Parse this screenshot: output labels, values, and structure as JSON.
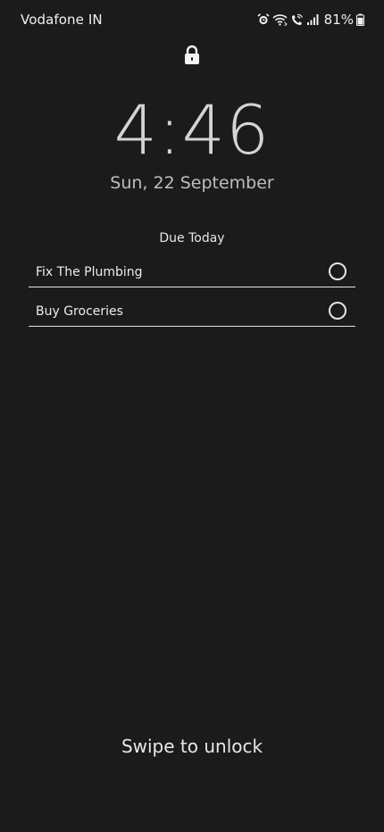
{
  "status_bar": {
    "carrier": "Vodafone IN",
    "icons": [
      "alarm-icon",
      "wifi-icon",
      "wifi-calling-icon",
      "signal-icon",
      "battery-icon"
    ],
    "battery_percent": "81%",
    "battery_level": 0.81
  },
  "lock_screen": {
    "lock_icon": "padlock-icon",
    "time": "4:46",
    "date": "Sun, 22 September"
  },
  "widget": {
    "title": "Due Today",
    "tasks": [
      {
        "label": "Fix The Plumbing",
        "checked": false
      },
      {
        "label": "Buy Groceries",
        "checked": false
      }
    ]
  },
  "footer": {
    "swipe_hint": "Swipe to unlock"
  },
  "colors": {
    "background": "#1b1b1b",
    "text": "#e8e8e8"
  }
}
